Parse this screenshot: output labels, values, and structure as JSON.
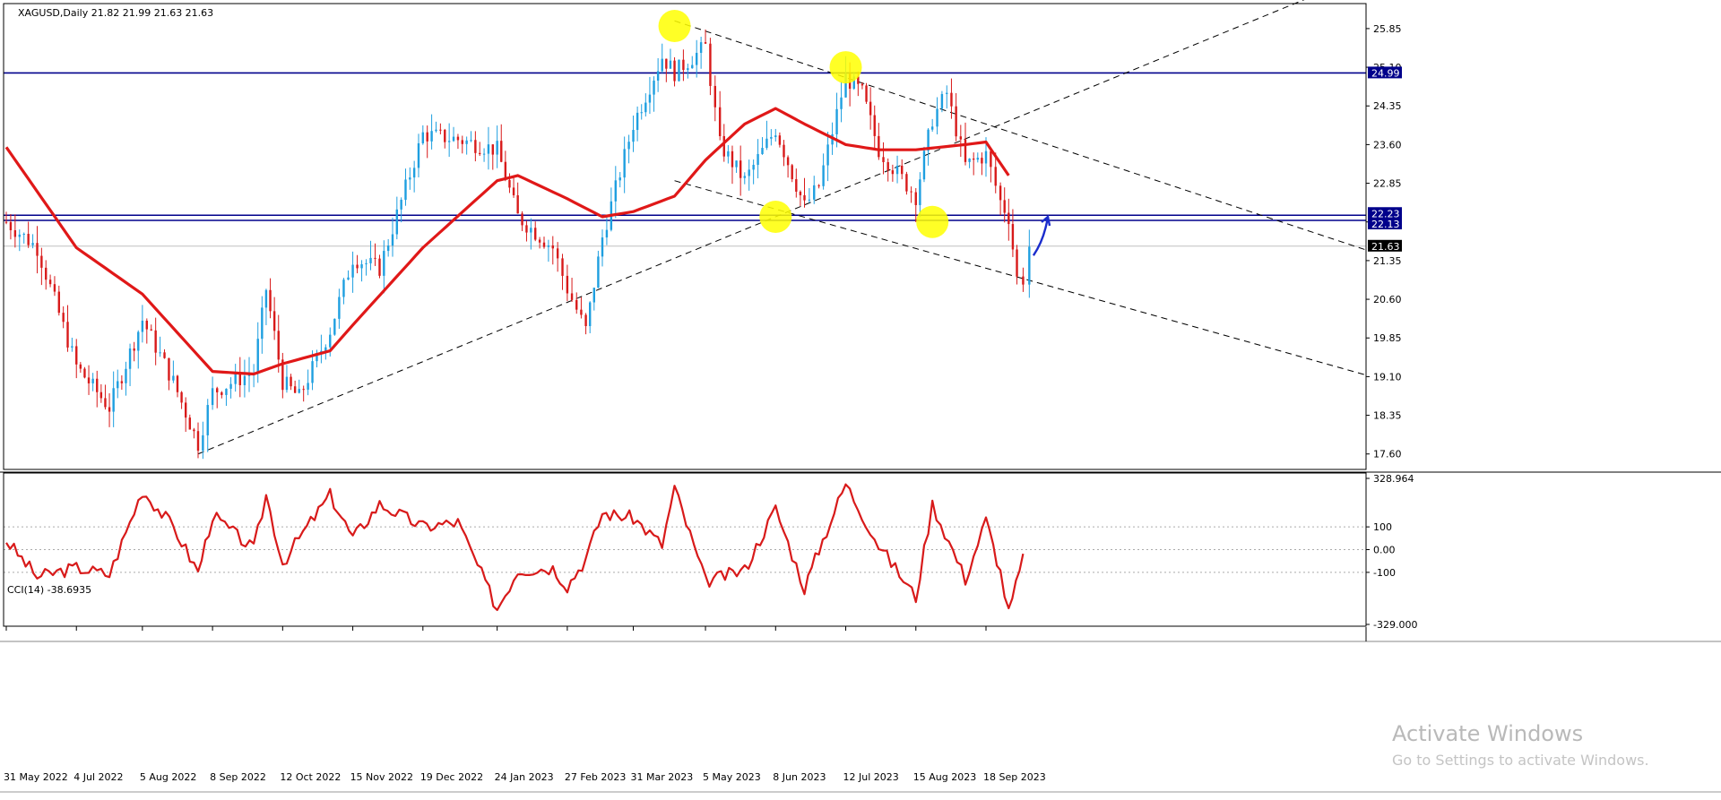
{
  "symbol_title": "XAGUSD,Daily  21.82 21.99 21.63 21.63",
  "indicator_title": "CCI(14) -38.6935",
  "windows_watermark": {
    "line1": "Activate Windows",
    "line2": "Go to Settings to activate Windows."
  },
  "colors": {
    "bull_candle": "#1e9fe0",
    "bear_candle": "#d81a1a",
    "moving_average": "#e01818",
    "cci_line": "#d81a1a",
    "resistance_line": "#00008b",
    "current_price_line": "#c0c0c0",
    "trend_lines": "#000000",
    "highlight_circles": "#ffff00",
    "arrow": "#1a2ccc"
  },
  "chart_data": [
    {
      "type": "candlestick",
      "title": "XAGUSD,Daily",
      "ohlc_header": [
        "21.82",
        "21.99",
        "21.63",
        "21.63"
      ],
      "ylim": [
        17.3,
        26.3
      ],
      "y_ticks": [
        "25.85",
        "25.10",
        "24.35",
        "23.60",
        "22.85",
        "22.10",
        "21.35",
        "20.60",
        "19.85",
        "19.10",
        "18.35",
        "17.60"
      ],
      "x_ticks": [
        "31 May 2022",
        "4 Jul 2022",
        "5 Aug 2022",
        "8 Sep 2022",
        "12 Oct 2022",
        "15 Nov 2022",
        "19 Dec 2022",
        "24 Jan 2023",
        "27 Feb 2023",
        "31 Mar 2023",
        "5 May 2023",
        "8 Jun 2023",
        "12 Jul 2023",
        "15 Aug 2023",
        "18 Sep 2023"
      ],
      "close_path": [
        [
          "31 May 2022",
          22.1
        ],
        [
          "15 Jun 2022",
          21.6
        ],
        [
          "4 Jul 2022",
          19.3
        ],
        [
          "20 Jul 2022",
          18.5
        ],
        [
          "5 Aug 2022",
          20.2
        ],
        [
          "20 Aug 2022",
          19.0
        ],
        [
          "1 Sep 2022",
          17.8
        ],
        [
          "8 Sep 2022",
          18.8
        ],
        [
          "28 Sep 2022",
          19.2
        ],
        [
          "4 Oct 2022",
          20.8
        ],
        [
          "12 Oct 2022",
          19.0
        ],
        [
          "20 Oct 2022",
          18.7
        ],
        [
          "4 Nov 2022",
          20.0
        ],
        [
          "15 Nov 2022",
          21.4
        ],
        [
          "28 Nov 2022",
          21.2
        ],
        [
          "19 Dec 2022",
          23.8
        ],
        [
          "5 Jan 2023",
          23.7
        ],
        [
          "24 Jan 2023",
          23.5
        ],
        [
          "3 Feb 2023",
          22.2
        ],
        [
          "20 Feb 2023",
          21.6
        ],
        [
          "27 Feb 2023",
          20.8
        ],
        [
          "8 Mar 2023",
          20.0
        ],
        [
          "16 Mar 2023",
          21.8
        ],
        [
          "31 Mar 2023",
          24.0
        ],
        [
          "14 Apr 2023",
          25.3
        ],
        [
          "20 Apr 2023",
          25.0
        ],
        [
          "5 May 2023",
          25.5
        ],
        [
          "12 May 2023",
          23.6
        ],
        [
          "24 May 2023",
          22.9
        ],
        [
          "8 Jun 2023",
          23.9
        ],
        [
          "22 Jun 2023",
          22.4
        ],
        [
          "29 Jun 2023",
          22.8
        ],
        [
          "12 Jul 2023",
          24.9
        ],
        [
          "20 Jul 2023",
          24.6
        ],
        [
          "28 Jul 2023",
          23.5
        ],
        [
          "15 Aug 2023",
          22.6
        ],
        [
          "23 Aug 2023",
          24.1
        ],
        [
          "30 Aug 2023",
          24.6
        ],
        [
          "8 Sep 2023",
          23.2
        ],
        [
          "18 Sep 2023",
          23.4
        ],
        [
          "25 Sep 2023",
          22.5
        ],
        [
          "29 Sep 2023",
          22.2
        ],
        [
          "3 Oct 2023",
          21.0
        ],
        [
          "6 Oct 2023",
          21.0
        ],
        [
          "9 Oct 2023",
          21.63
        ]
      ],
      "moving_average_path": [
        [
          "31 May 2022",
          23.55
        ],
        [
          "4 Jul 2022",
          21.6
        ],
        [
          "5 Aug 2022",
          20.7
        ],
        [
          "8 Sep 2022",
          19.2
        ],
        [
          "28 Sep 2022",
          19.15
        ],
        [
          "12 Oct 2022",
          19.35
        ],
        [
          "4 Nov 2022",
          19.6
        ],
        [
          "15 Nov 2022",
          20.1
        ],
        [
          "19 Dec 2022",
          21.6
        ],
        [
          "24 Jan 2023",
          22.9
        ],
        [
          "3 Feb 2023",
          23.0
        ],
        [
          "27 Feb 2023",
          22.55
        ],
        [
          "16 Mar 2023",
          22.2
        ],
        [
          "31 Mar 2023",
          22.3
        ],
        [
          "20 Apr 2023",
          22.6
        ],
        [
          "5 May 2023",
          23.3
        ],
        [
          "24 May 2023",
          24.0
        ],
        [
          "8 Jun 2023",
          24.3
        ],
        [
          "22 Jun 2023",
          24.0
        ],
        [
          "12 Jul 2023",
          23.6
        ],
        [
          "28 Jul 2023",
          23.5
        ],
        [
          "15 Aug 2023",
          23.5
        ],
        [
          "8 Sep 2023",
          23.6
        ],
        [
          "18 Sep 2023",
          23.65
        ],
        [
          "29 Sep 2023",
          23.0
        ]
      ],
      "horizontal_levels": [
        {
          "price": 24.99,
          "label": "24.99"
        },
        {
          "price": 22.23,
          "label": "22.23"
        },
        {
          "price": 22.13,
          "label": "22.13"
        }
      ],
      "current_price": {
        "price": 21.63,
        "label": "21.63"
      },
      "trend_lines": [
        {
          "from": [
            "1 Sep 2022",
            17.6
          ],
          "to": [
            "8 Jun 2023",
            22.2
          ],
          "extends": "right"
        },
        {
          "from": [
            "20 Apr 2023",
            26.0
          ],
          "to": [
            "12 Jul 2023",
            24.9
          ],
          "extends": "right"
        },
        {
          "from": [
            "20 Apr 2023",
            22.9
          ],
          "to": [
            "6 Oct 2023",
            21.0
          ],
          "extends": "right"
        }
      ],
      "highlighted_points": [
        [
          "20 Apr 2023",
          25.9
        ],
        [
          "12 Jul 2023",
          25.1
        ],
        [
          "8 Jun 2023",
          22.2
        ],
        [
          "23 Aug 2023",
          22.1
        ]
      ],
      "annotation": {
        "type": "arrow",
        "direction": "up",
        "from": [
          "11 Oct 2023",
          21.45
        ],
        "to": [
          "18 Oct 2023",
          22.2
        ]
      }
    },
    {
      "type": "line",
      "title": "CCI(14)",
      "ylim": [
        -329,
        329
      ],
      "y_ticks": [
        "328.964",
        "100",
        "0.00",
        "-100",
        "-329.000"
      ],
      "reference_levels": [
        100,
        0,
        -100
      ],
      "series": [
        {
          "values_by_date": [
            [
              "31 May 2022",
              40
            ],
            [
              "15 Jun 2022",
              -120
            ],
            [
              "4 Jul 2022",
              -80
            ],
            [
              "20 Jul 2022",
              -110
            ],
            [
              "5 Aug 2022",
              260
            ],
            [
              "20 Aug 2022",
              100
            ],
            [
              "1 Sep 2022",
              -100
            ],
            [
              "8 Sep 2022",
              150
            ],
            [
              "28 Sep 2022",
              0
            ],
            [
              "4 Oct 2022",
              240
            ],
            [
              "12 Oct 2022",
              -60
            ],
            [
              "20 Oct 2022",
              50
            ],
            [
              "4 Nov 2022",
              240
            ],
            [
              "15 Nov 2022",
              50
            ],
            [
              "28 Nov 2022",
              200
            ],
            [
              "19 Dec 2022",
              100
            ],
            [
              "5 Jan 2023",
              120
            ],
            [
              "24 Jan 2023",
              -260
            ],
            [
              "3 Feb 2023",
              -90
            ],
            [
              "20 Feb 2023",
              -80
            ],
            [
              "27 Feb 2023",
              -160
            ],
            [
              "8 Mar 2023",
              -40
            ],
            [
              "16 Mar 2023",
              160
            ],
            [
              "31 Mar 2023",
              140
            ],
            [
              "14 Apr 2023",
              20
            ],
            [
              "20 Apr 2023",
              270
            ],
            [
              "5 May 2023",
              -140
            ],
            [
              "24 May 2023",
              -90
            ],
            [
              "8 Jun 2023",
              180
            ],
            [
              "22 Jun 2023",
              -170
            ],
            [
              "29 Jun 2023",
              0
            ],
            [
              "12 Jul 2023",
              290
            ],
            [
              "28 Jul 2023",
              20
            ],
            [
              "15 Aug 2023",
              -210
            ],
            [
              "23 Aug 2023",
              200
            ],
            [
              "8 Sep 2023",
              -130
            ],
            [
              "18 Sep 2023",
              130
            ],
            [
              "25 Sep 2023",
              -100
            ],
            [
              "29 Sep 2023",
              -280
            ],
            [
              "6 Oct 2023",
              -40
            ]
          ]
        }
      ]
    }
  ]
}
